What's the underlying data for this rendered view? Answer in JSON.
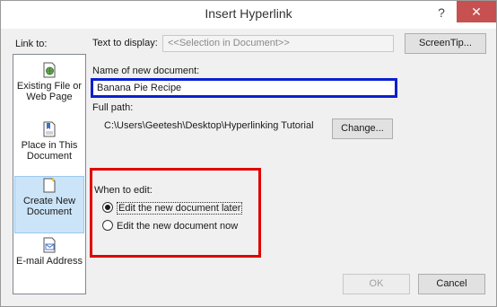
{
  "window": {
    "title": "Insert Hyperlink",
    "help_glyph": "?",
    "close_glyph": "✕"
  },
  "link_to": {
    "label": "Link to:",
    "items": [
      {
        "label": "Existing File or Web Page",
        "icon": "globe-page-icon",
        "selected": false
      },
      {
        "label": "Place in This Document",
        "icon": "document-bookmark-icon",
        "selected": false
      },
      {
        "label": "Create New Document",
        "icon": "new-document-icon",
        "selected": true
      },
      {
        "label": "E-mail Address",
        "icon": "email-icon",
        "selected": false
      }
    ]
  },
  "text_to_display": {
    "label": "Text to display:",
    "value": "<<Selection in Document>>"
  },
  "screentip_button": "ScreenTip...",
  "name_of_new_document": {
    "label": "Name of new document:",
    "value": "Banana Pie Recipe"
  },
  "full_path": {
    "label": "Full path:",
    "value": "C:\\Users\\Geetesh\\Desktop\\Hyperlinking Tutorial",
    "change_button": "Change..."
  },
  "when_to_edit": {
    "label": "When to edit:",
    "options": [
      {
        "label": "Edit the new document later",
        "checked": true
      },
      {
        "label": "Edit the new document now",
        "checked": false
      }
    ]
  },
  "buttons": {
    "ok": "OK",
    "cancel": "Cancel"
  },
  "colors": {
    "highlight_blue": "#0b1fd0",
    "highlight_red": "#e00000",
    "close_button": "#c75050",
    "selected_item": "#cce4f7"
  }
}
